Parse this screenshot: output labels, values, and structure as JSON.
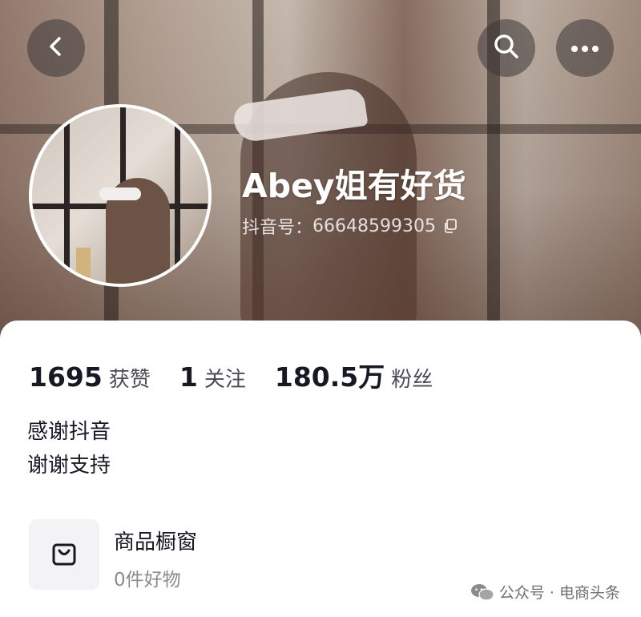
{
  "header": {
    "account_name": "Abey姐有好货",
    "douyin_id_label": "抖音号：",
    "douyin_id": "66648599305",
    "icons": {
      "back": "back-arrow-icon",
      "search": "search-icon",
      "more": "more-dots-icon",
      "copy": "copy-icon"
    }
  },
  "stats": [
    {
      "value": "1695",
      "label": "获赞"
    },
    {
      "value": "1",
      "label": "关注"
    },
    {
      "value": "180.5万",
      "label": "粉丝"
    }
  ],
  "bio": {
    "line1": "感谢抖音",
    "line2": "谢谢支持"
  },
  "shop": {
    "title": "商品橱窗",
    "subtitle": "0件好物",
    "icon": "shopping-bag-icon"
  },
  "watermark": {
    "text": "公众号 · 电商头条",
    "icon": "wechat-icon"
  },
  "colors": {
    "primary_text": "#161823",
    "secondary_text": "#8a8b91",
    "card_bg": "#ffffff"
  }
}
